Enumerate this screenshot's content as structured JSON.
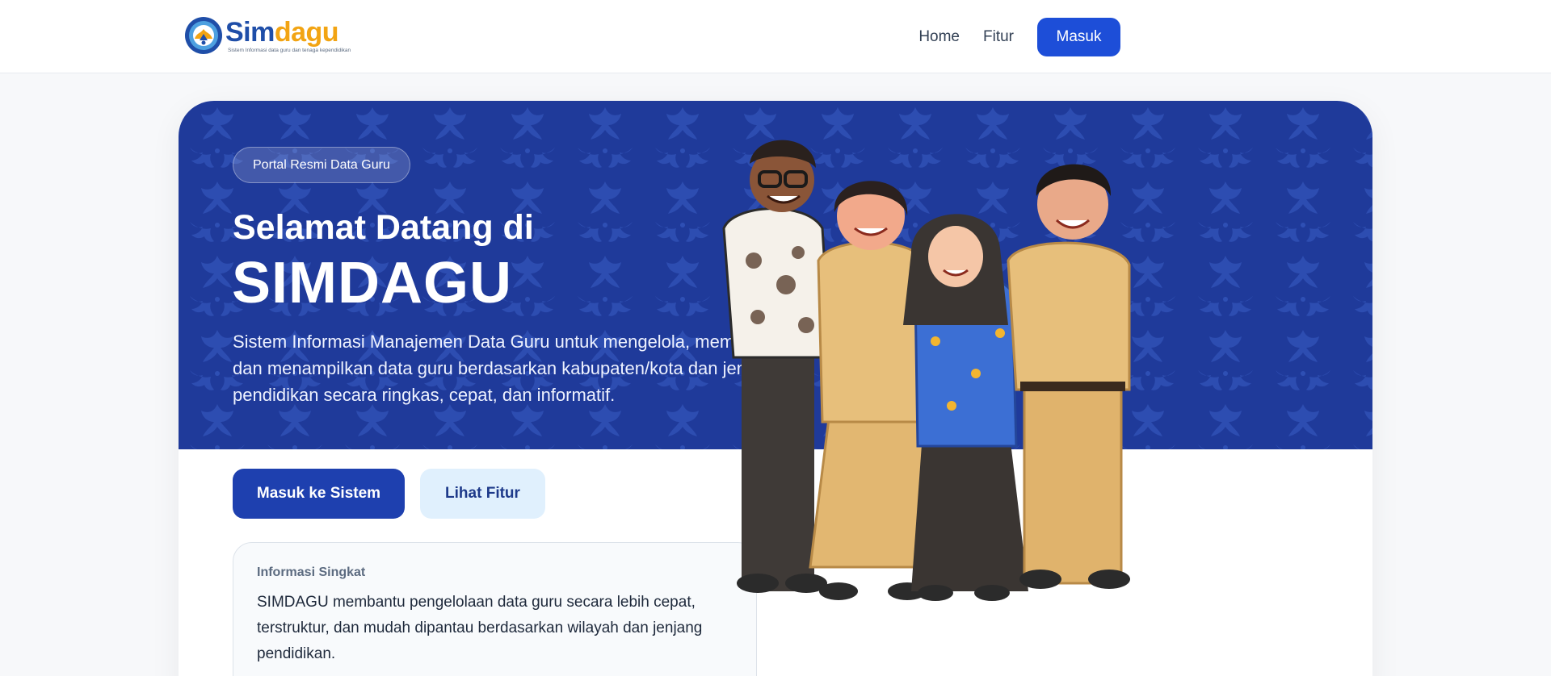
{
  "header": {
    "logo": {
      "word_primary": "Sim",
      "word_accent": "dagu",
      "tagline": "Sistem Informasi data guru dan tenaga kependidikan"
    },
    "nav": [
      {
        "label": "Home"
      },
      {
        "label": "Fitur"
      }
    ],
    "login_label": "Masuk"
  },
  "hero": {
    "badge": "Portal Resmi Data Guru",
    "title_line1": "Selamat Datang di",
    "title_line2": "SIMDAGU",
    "description": "Sistem Informasi Manajemen Data Guru untuk mengelola, memantau, dan menampilkan data guru berdasarkan kabupaten/kota dan jenjang pendidikan secara ringkas, cepat, dan informatif.",
    "primary_button": "Masuk ke Sistem",
    "secondary_button": "Lihat Fitur"
  },
  "info": {
    "title": "Informasi Singkat",
    "text": "SIMDAGU membantu pengelolaan data guru secara lebih cepat, terstruktur, dan mudah dipantau berdasarkan wilayah dan jenjang pendidikan."
  },
  "icons": {
    "logo_emblem": "tut-wuri-handayani-emblem-icon",
    "illustration": "teachers-group-illustration"
  },
  "colors": {
    "brand_blue": "#1f4ea8",
    "brand_yellow": "#f2a413",
    "banner_blue": "#1f3a9a",
    "primary_button": "#1e40af",
    "login_button": "#1d4ed8",
    "secondary_button": "#e0f0fd"
  }
}
